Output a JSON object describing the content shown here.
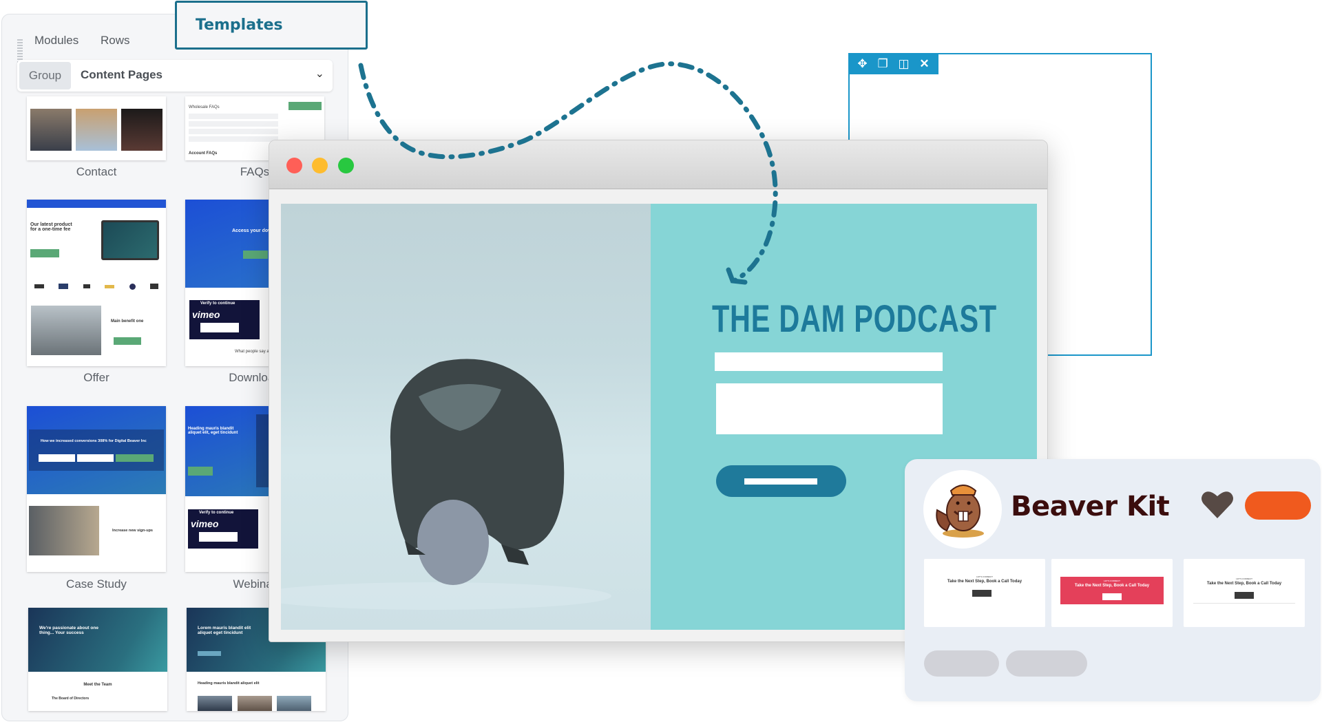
{
  "builder_panel": {
    "tabs": [
      {
        "label": "Modules",
        "active": false
      },
      {
        "label": "Rows",
        "active": false
      },
      {
        "label": "Templates",
        "active": true
      }
    ],
    "group_label": "Group",
    "group_select_value": "Content Pages",
    "templates": [
      {
        "label": "Contact"
      },
      {
        "label": "FAQs"
      },
      {
        "label": "Offer"
      },
      {
        "label": "Download"
      },
      {
        "label": "Case Study"
      },
      {
        "label": "Webinar"
      },
      {
        "label": ""
      },
      {
        "label": ""
      }
    ],
    "thumb_text": {
      "faq_heading": "Wholesale FAQs",
      "faq_heading2": "Account FAQs",
      "offer_heading": "Our latest product for a one-time fee",
      "offer_sub": "Main benefit one",
      "download_heading": "Access your download",
      "verify": "Verify to continue",
      "vimeo": "vimeo",
      "download_footer": "What people say about",
      "case_heading": "How we increased conversions 308% for Digital Beaver Inc",
      "case_sub": "Increase new sign-ups",
      "webinar_heading": "Heading mauris blandit aliquet elit, eget tincidunt",
      "about_heading": "We're passionate about one thing... Your success",
      "about_sub": "Meet the Team",
      "about_sub2": "The Board of Directors",
      "lorem_heading": "Lorem mauris blandit elit aliquet eget tincidunt",
      "lorem_sub": "Heading mauris blandit aliquet elit"
    }
  },
  "row_toolbar": {
    "icons": [
      "move-icon",
      "duplicate-icon",
      "columns-icon",
      "close-icon"
    ],
    "glyphs": [
      "✥",
      "❐",
      "◫",
      "✕"
    ]
  },
  "browser": {
    "traffic_lights": {
      "close": "#ff5f57",
      "minimize": "#febc2e",
      "maximize": "#28c840"
    },
    "page": {
      "title": "THE DAM PODCAST",
      "accent": "#1d7a9b",
      "background": "#86d5d6"
    }
  },
  "beaver_kit": {
    "title": "Beaver Kit",
    "cta_color": "#f05a1e",
    "heart_color": "#574a45",
    "previews": [
      {
        "eyebrow": "LET'S CONNECT",
        "heading": "Take the Next Step, Book a Call Today",
        "style": "light"
      },
      {
        "eyebrow": "LET'S CONNECT",
        "heading": "Take the Next Step, Book a Call Today",
        "style": "red"
      },
      {
        "eyebrow": "LET'S CONNECT",
        "heading": "Take the Next Step, Book a Call Today",
        "style": "light"
      }
    ]
  },
  "colors": {
    "templates_accent": "#1b6f8c",
    "row_outline": "#1a96c9",
    "dashed_arrow": "#1d7390"
  }
}
